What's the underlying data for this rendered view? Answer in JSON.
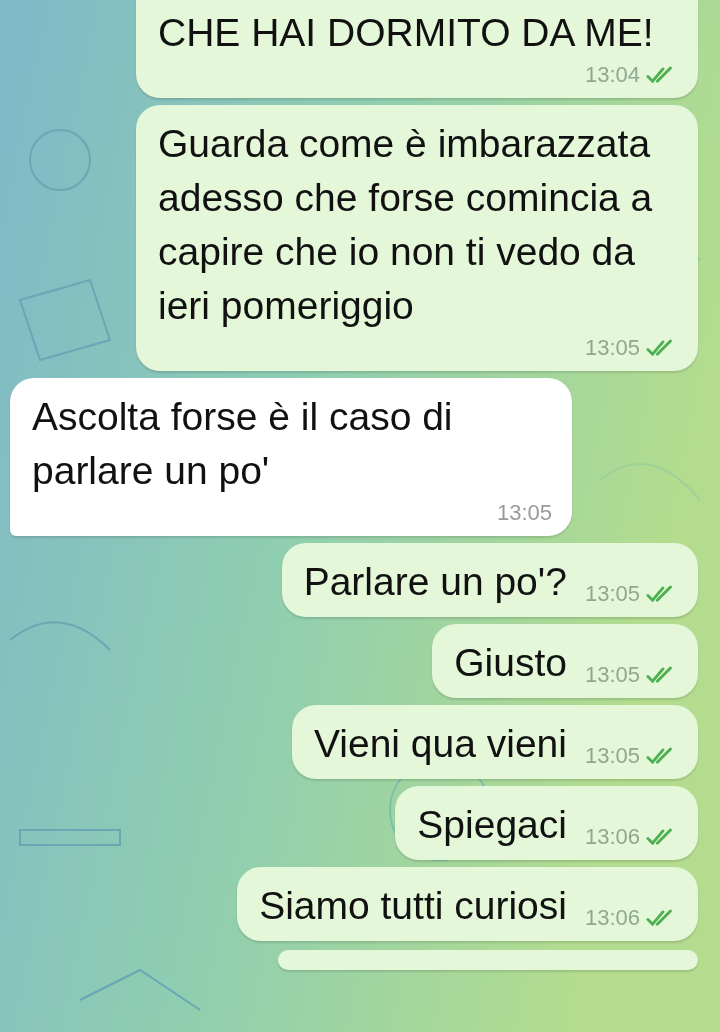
{
  "messages": [
    {
      "kind": "outgoing",
      "text": "CHE HAI DORMITO DA ME!",
      "time": "13:04",
      "read": true
    },
    {
      "kind": "outgoing",
      "text": "Guarda come è imbarazzata adesso che forse comincia a capire che io non ti vedo da ieri pomeriggio",
      "time": "13:05",
      "read": true
    },
    {
      "kind": "incoming",
      "text": "Ascolta forse è il caso di parlare un po'",
      "time": "13:05"
    },
    {
      "kind": "outgoing",
      "text": "Parlare un po'?",
      "time": "13:05",
      "read": true
    },
    {
      "kind": "outgoing",
      "text": "Giusto",
      "time": "13:05",
      "read": true
    },
    {
      "kind": "outgoing",
      "text": "Vieni qua vieni",
      "time": "13:05",
      "read": true
    },
    {
      "kind": "outgoing",
      "text": "Spiegaci",
      "time": "13:06",
      "read": true
    },
    {
      "kind": "outgoing",
      "text": "Siamo tutti curiosi",
      "time": "13:06",
      "read": true
    }
  ],
  "cut_off_message": {
    "kind": "outgoing"
  }
}
